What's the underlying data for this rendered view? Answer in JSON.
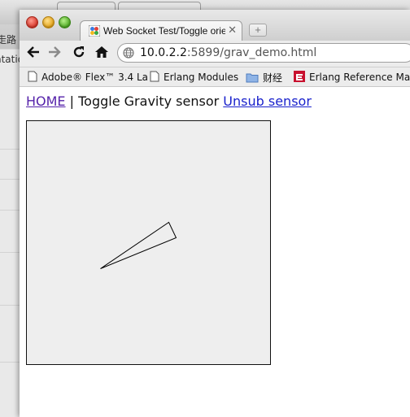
{
  "background_window": {
    "sidebar_texts": [
      "走路",
      "ntatio"
    ]
  },
  "window": {
    "tab": {
      "title": "Web Socket Test/Toggle orie",
      "close_glyph": "✕"
    },
    "new_tab_glyph": "+",
    "toolbar": {
      "url_host": "10.0.2.2",
      "url_rest": ":5899/grav_demo.html"
    },
    "bookmarks": [
      {
        "label": "Adobe® Flex™ 3.4 La",
        "icon": "page-icon"
      },
      {
        "label": "Erlang Modules",
        "icon": "page-icon"
      },
      {
        "label": "财经",
        "icon": "folder-icon"
      },
      {
        "label": "Erlang Reference Mar",
        "icon": "erlang-icon"
      }
    ]
  },
  "page": {
    "home_link": "HOME",
    "separator": "|",
    "title_text": "Toggle Gravity sensor",
    "unsub_link": "Unsub sensor"
  },
  "gravity_canvas": {
    "background": "#eeeeee",
    "pointer_triangle": "origin (91,182); tips (175,125), (184,144) in a 301×301 canvas"
  },
  "colors": {
    "home_link": "#5522aa",
    "unsub_link": "#1a22cc"
  }
}
